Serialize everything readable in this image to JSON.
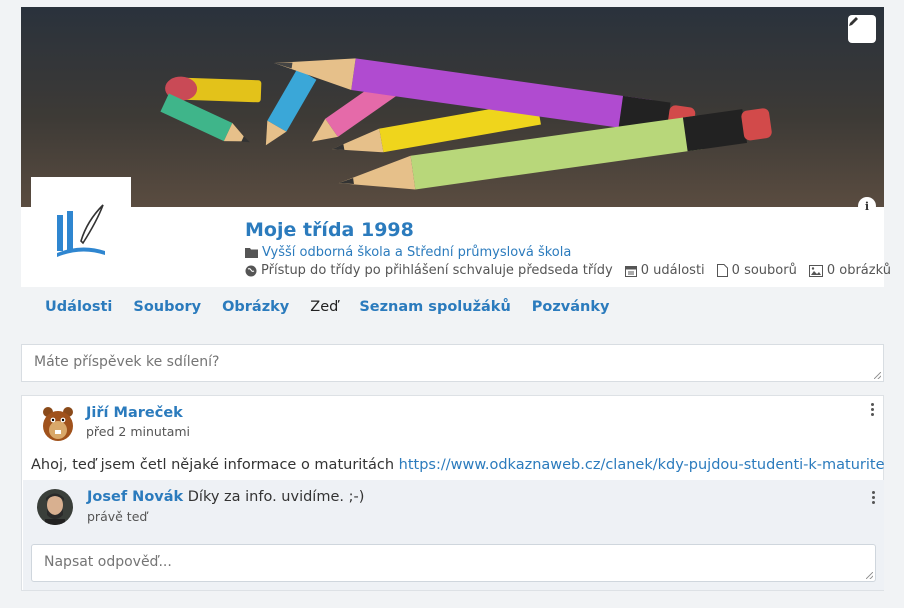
{
  "group": {
    "title": "Moje třída 1998",
    "school": "Vyšší odborná škola a Střední průmyslová škola",
    "access": "Přístup do třídy po přihlášení schvaluje předseda třídy",
    "events": "0 události",
    "files": "0 souborů",
    "images": "0 obrázků"
  },
  "tabs": [
    {
      "label": "Události",
      "active": false
    },
    {
      "label": "Soubory",
      "active": false
    },
    {
      "label": "Obrázky",
      "active": false
    },
    {
      "label": "Zeď",
      "active": true
    },
    {
      "label": "Seznam spolužáků",
      "active": false
    },
    {
      "label": "Pozvánky",
      "active": false
    }
  ],
  "share": {
    "placeholder": "Máte příspěvek ke sdílení?"
  },
  "post": {
    "author": "Jiří Mareček",
    "time": "před 2 minutami",
    "text": "Ahoj, teď jsem četl nějaké informace o maturitách",
    "link": "https://www.odkaznaweb.cz/clanek/kdy-pujdou-studenti-k-maturite",
    "comment": {
      "author": "Josef Novák",
      "text": "Díky za info. uvidíme. ;-)",
      "time": "právě teď"
    },
    "reply_placeholder": "Napsat odpověď..."
  },
  "icons": {
    "edit": "pencil-icon",
    "info": "info-icon",
    "folder": "folder-icon",
    "globe": "globe-icon",
    "calendar": "calendar-icon",
    "file": "file-icon",
    "image": "image-icon",
    "menu": "kebab-menu-icon"
  },
  "colors": {
    "accent": "#2b7bbd",
    "background": "#f1f3f5"
  }
}
